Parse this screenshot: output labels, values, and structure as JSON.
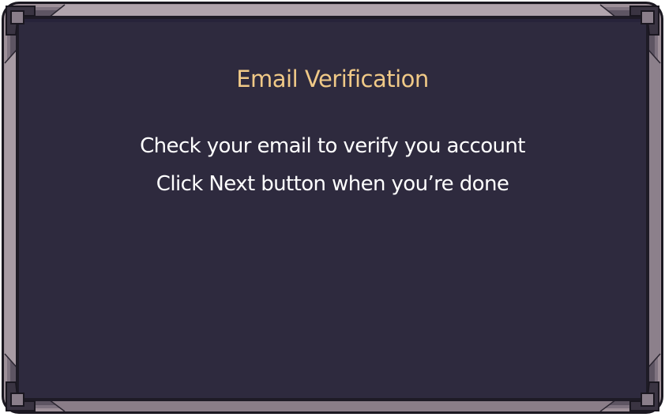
{
  "dialog": {
    "title": "Email Verification",
    "message_line1": "Check your email to verify you account",
    "message_line2": "Click Next button when you’re done"
  },
  "colors": {
    "panel_background": "#2e2a3e",
    "frame_outer": "#9e9099",
    "frame_dark": "#221f2b",
    "title": "#f0c987",
    "text": "#ffffff"
  }
}
